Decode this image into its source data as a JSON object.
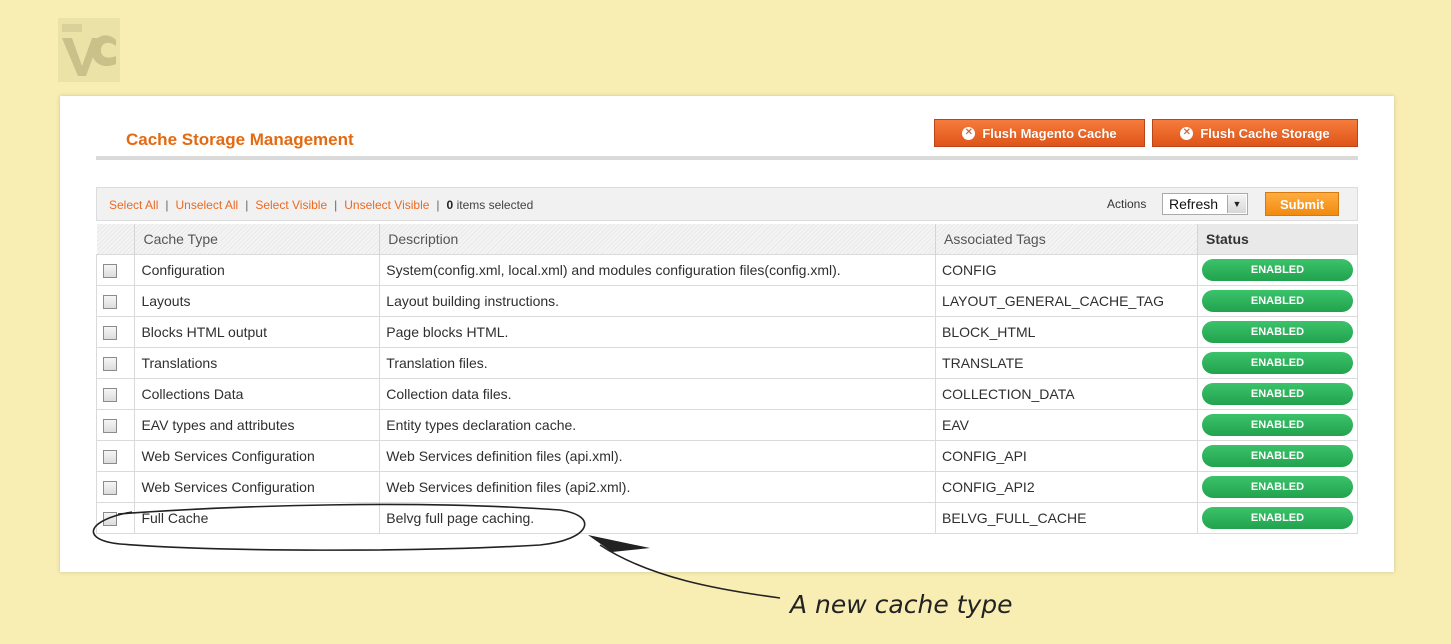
{
  "page": {
    "title": "Cache Storage Management",
    "buttons": {
      "flush_magento": "Flush Magento Cache",
      "flush_storage": "Flush Cache Storage"
    }
  },
  "massaction": {
    "select_all": "Select All",
    "unselect_all": "Unselect All",
    "select_visible": "Select Visible",
    "unselect_visible": "Unselect Visible",
    "separator": "|",
    "selected_count": "0",
    "selected_suffix": "items selected",
    "actions_label": "Actions",
    "action_value": "Refresh",
    "submit": "Submit"
  },
  "grid": {
    "headers": {
      "cache_type": "Cache Type",
      "description": "Description",
      "tags": "Associated Tags",
      "status": "Status"
    },
    "rows": [
      {
        "type": "Configuration",
        "desc": "System(config.xml, local.xml) and modules configuration files(config.xml).",
        "tags": "CONFIG",
        "status": "ENABLED"
      },
      {
        "type": "Layouts",
        "desc": "Layout building instructions.",
        "tags": "LAYOUT_GENERAL_CACHE_TAG",
        "status": "ENABLED"
      },
      {
        "type": "Blocks HTML output",
        "desc": "Page blocks HTML.",
        "tags": "BLOCK_HTML",
        "status": "ENABLED"
      },
      {
        "type": "Translations",
        "desc": "Translation files.",
        "tags": "TRANSLATE",
        "status": "ENABLED"
      },
      {
        "type": "Collections Data",
        "desc": "Collection data files.",
        "tags": "COLLECTION_DATA",
        "status": "ENABLED"
      },
      {
        "type": "EAV types and attributes",
        "desc": "Entity types declaration cache.",
        "tags": "EAV",
        "status": "ENABLED"
      },
      {
        "type": "Web Services Configuration",
        "desc": "Web Services definition files (api.xml).",
        "tags": "CONFIG_API",
        "status": "ENABLED"
      },
      {
        "type": "Web Services Configuration",
        "desc": "Web Services definition files (api2.xml).",
        "tags": "CONFIG_API2",
        "status": "ENABLED"
      },
      {
        "type": "Full Cache",
        "desc": "Belvg full page caching.",
        "tags": "BELVG_FULL_CACHE",
        "status": "ENABLED"
      }
    ]
  },
  "annotation": {
    "text": "A new cache type"
  },
  "icons": {
    "logo": "belvg-logo-icon",
    "flush": "close-circle-icon",
    "dropdown": "chevron-down-icon",
    "checkbox": "checkbox-icon"
  },
  "colors": {
    "background": "#f8eeb4",
    "title": "#e26a12",
    "button": "#df5418",
    "submit": "#f18a10",
    "enabled": "#22a24e"
  }
}
